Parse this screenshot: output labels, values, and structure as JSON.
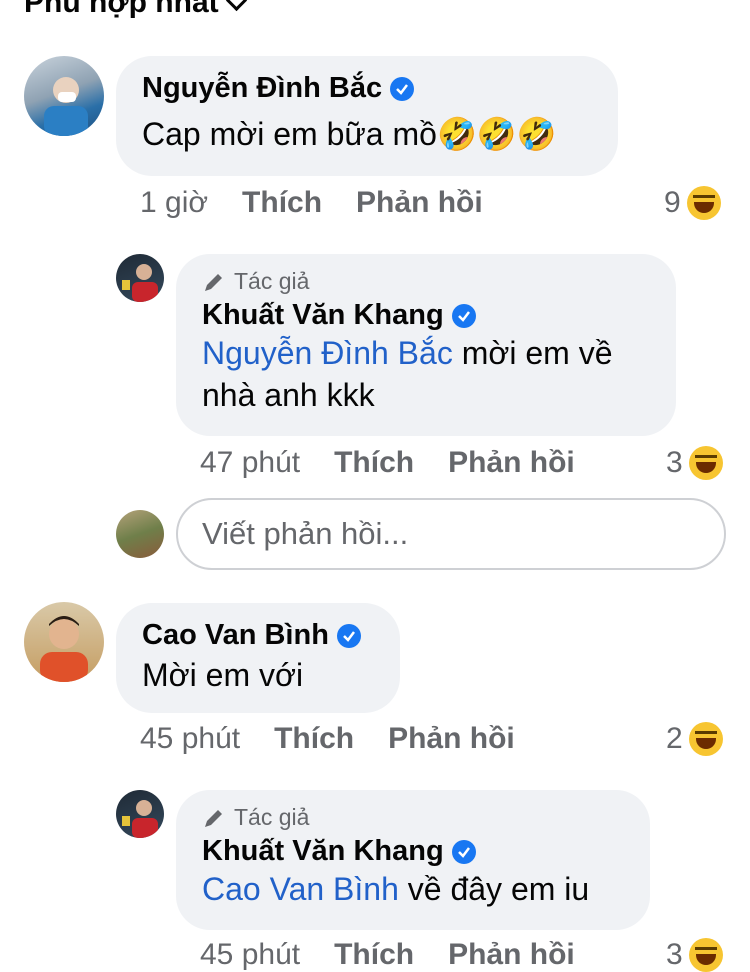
{
  "sort": {
    "label": "Phù hợp nhất"
  },
  "comments": [
    {
      "name": "Nguyễn Đình Bắc",
      "text": "Cap mời em bữa mồ🤣🤣🤣",
      "time": "1 giờ",
      "like": "Thích",
      "reply": "Phản hồi",
      "reaction_count": "9"
    },
    {
      "name": "Cao Van Bình",
      "text": "Mời em với",
      "time": "45 phút",
      "like": "Thích",
      "reply": "Phản hồi",
      "reaction_count": "2"
    }
  ],
  "replies": [
    {
      "author_tag": "Tác giả",
      "name": "Khuất Văn Khang",
      "mention": "Nguyễn Đình Bắc",
      "text": " mời em về nhà anh kkk",
      "time": "47 phút",
      "like": "Thích",
      "reply": "Phản hồi",
      "reaction_count": "3"
    },
    {
      "author_tag": "Tác giả",
      "name": "Khuất Văn Khang",
      "mention": "Cao Van Bình",
      "text": " về đây em iu",
      "time": "45 phút",
      "like": "Thích",
      "reply": "Phản hồi",
      "reaction_count": "3"
    }
  ],
  "reply_input": {
    "placeholder": "Viết phản hồi..."
  }
}
